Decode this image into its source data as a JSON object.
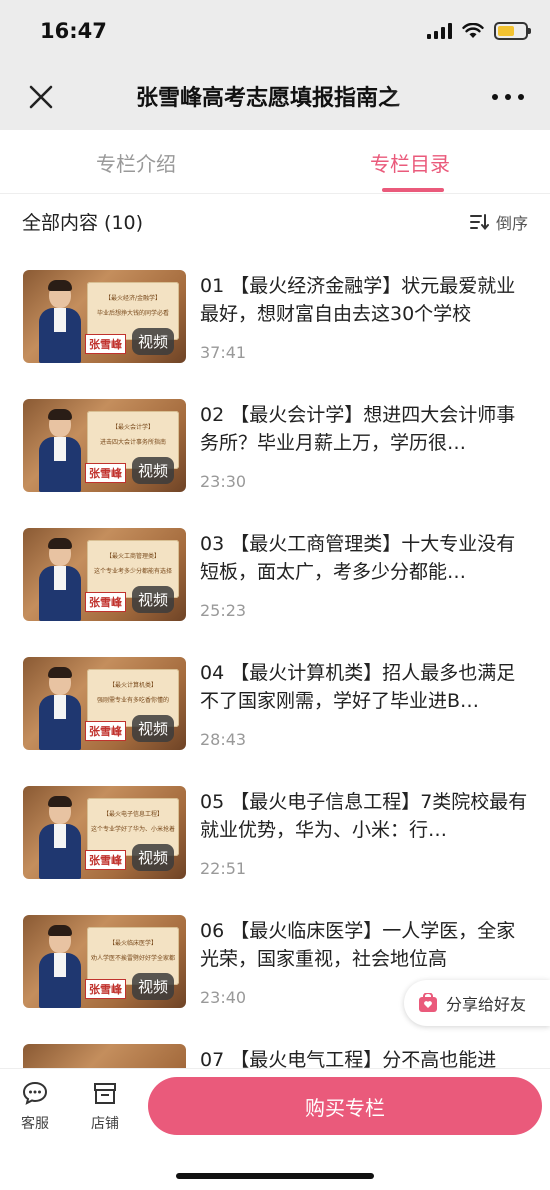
{
  "status_bar": {
    "time": "16:47"
  },
  "nav": {
    "title": "张雪峰高考志愿填报指南之"
  },
  "tabs": {
    "intro": "专栏介绍",
    "catalog": "专栏目录",
    "active": "catalog"
  },
  "list_header": {
    "all_content": "全部内容 (10)",
    "sort_label": "倒序"
  },
  "thumb_common": {
    "name_tag": "张雪峰",
    "badge": "视频"
  },
  "items": [
    {
      "title": "01 【最火经济金融学】状元最爱就业最好，想财富自由去这30个学校",
      "duration": "37:41",
      "thumb_l1": "【最火经济/金融学】",
      "thumb_l2": "毕业后想挣大钱的同学必看"
    },
    {
      "title": "02 【最火会计学】想进四大会计师事务所？毕业月薪上万，学历很…",
      "duration": "23:30",
      "thumb_l1": "【最火会计学】",
      "thumb_l2": "进击四大会计事务所指南"
    },
    {
      "title": "03 【最火工商管理类】十大专业没有短板，面太广，考多少分都能…",
      "duration": "25:23",
      "thumb_l1": "【最火工商管理类】",
      "thumb_l2": "这个专业考多少分都能有选择"
    },
    {
      "title": "04 【最火计算机类】招人最多也满足不了国家刚需，学好了毕业进B…",
      "duration": "28:43",
      "thumb_l1": "【最火计算机类】",
      "thumb_l2": "强刚需专业有多吃香你懂的"
    },
    {
      "title": "05 【最火电子信息工程】7类院校最有就业优势，华为、小米：行…",
      "duration": "22:51",
      "thumb_l1": "【最火电子信息工程】",
      "thumb_l2": "这个专业学好了华为、小米抢着要"
    },
    {
      "title": "06 【最火临床医学】一人学医，全家光荣，国家重视，社会地位高",
      "duration": "23:40",
      "thumb_l1": "【最火临床医学】",
      "thumb_l2": "劝人学医不挨雷劈好好学全家都光荣"
    },
    {
      "title": "07 【最火电气工程】分不高也能进",
      "duration": "",
      "thumb_l1": "",
      "thumb_l2": ""
    }
  ],
  "share": {
    "label": "分享给好友"
  },
  "bottom_bar": {
    "service_label": "客服",
    "shop_label": "店铺",
    "buy_label": "购买专栏"
  },
  "colors": {
    "accent": "#ea5a7b",
    "topbar_bg": "#ececec"
  }
}
